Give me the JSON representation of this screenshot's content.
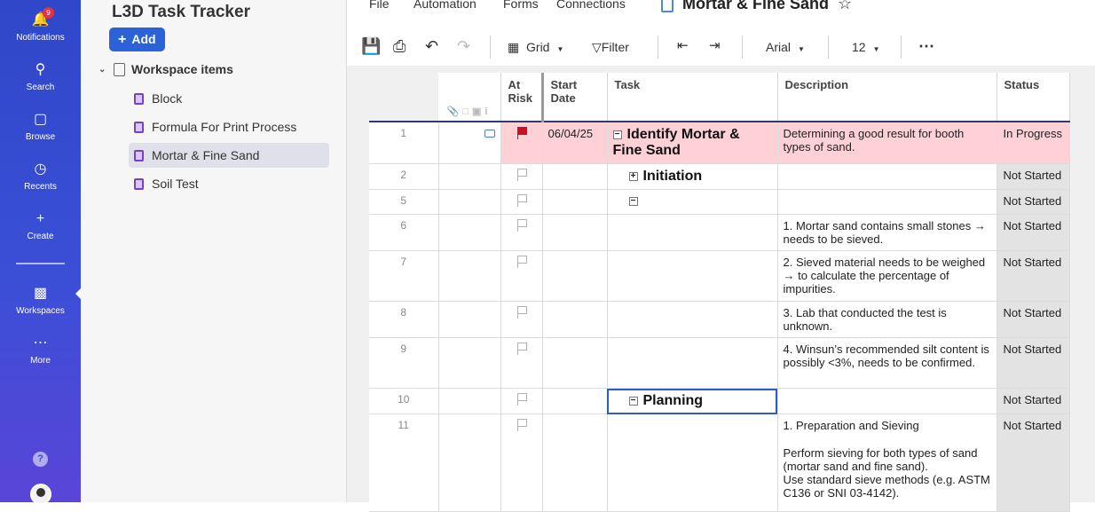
{
  "rail": {
    "notifications": {
      "label": "Notifications",
      "badge": "9"
    },
    "search": {
      "label": "Search"
    },
    "browse": {
      "label": "Browse"
    },
    "recents": {
      "label": "Recents"
    },
    "create": {
      "label": "Create"
    },
    "workspaces": {
      "label": "Workspaces"
    },
    "more": {
      "label": "More"
    },
    "help": "?"
  },
  "sidebar": {
    "title": "L3D Task Tracker",
    "add_label": "Add",
    "workspace_label": "Workspace items",
    "items": [
      {
        "label": "Block",
        "active": false
      },
      {
        "label": "Formula For Print Process",
        "active": false
      },
      {
        "label": "Mortar & Fine Sand",
        "active": true
      },
      {
        "label": "Soil Test",
        "active": false
      }
    ]
  },
  "menu": {
    "file": "File",
    "automation": "Automation",
    "forms": "Forms",
    "connections": "Connections",
    "doc_title": "Mortar & Fine Sand"
  },
  "toolbar": {
    "grid_label": "Grid",
    "filter_label": "Filter",
    "font": "Arial",
    "font_size": "12"
  },
  "columns": {
    "at_risk": "At Risk",
    "start_date": "Start Date",
    "task": "Task",
    "description": "Description",
    "status": "Status"
  },
  "rows": [
    {
      "num": "1",
      "risk_flag": "red",
      "start": "06/04/25",
      "toggle": "−",
      "task": "Identify Mortar & Fine Sand",
      "task_style": "big",
      "desc": "Determining a good result for booth types of sand.",
      "status": "In Progress",
      "highlight": true
    },
    {
      "num": "2",
      "toggle": "+",
      "task": "Initiation",
      "task_style": "big",
      "desc": "",
      "status": "Not Started"
    },
    {
      "num": "5",
      "toggle": "−",
      "task": "",
      "desc": "",
      "status": "Not Started"
    },
    {
      "num": "6",
      "task": "",
      "desc": "1. Mortar sand contains small stones → needs to be sieved.",
      "status": "Not Started"
    },
    {
      "num": "7",
      "task": "",
      "desc": "2. Sieved material needs to be weighed → to calculate the percentage of impurities.",
      "status": "Not Started"
    },
    {
      "num": "8",
      "task": "",
      "desc": "3. Lab that conducted the test is unknown.",
      "status": "Not Started"
    },
    {
      "num": "9",
      "task": "",
      "desc": "4. Winsun’s recommended silt content is possibly <3%, needs to be confirmed.",
      "status": "Not Started"
    },
    {
      "num": "10",
      "toggle": "−",
      "task": "Planning",
      "task_style": "big",
      "desc": "",
      "status": "Not Started",
      "selected": true
    },
    {
      "num": "11",
      "task": "",
      "desc": "1. Preparation and Sieving",
      "desc2": "Perform sieving for both types of sand (mortar sand and fine sand).",
      "desc3": "Use standard sieve methods (e.g. ASTM C136 or SNI 03-4142).",
      "status": "Not Started"
    }
  ]
}
